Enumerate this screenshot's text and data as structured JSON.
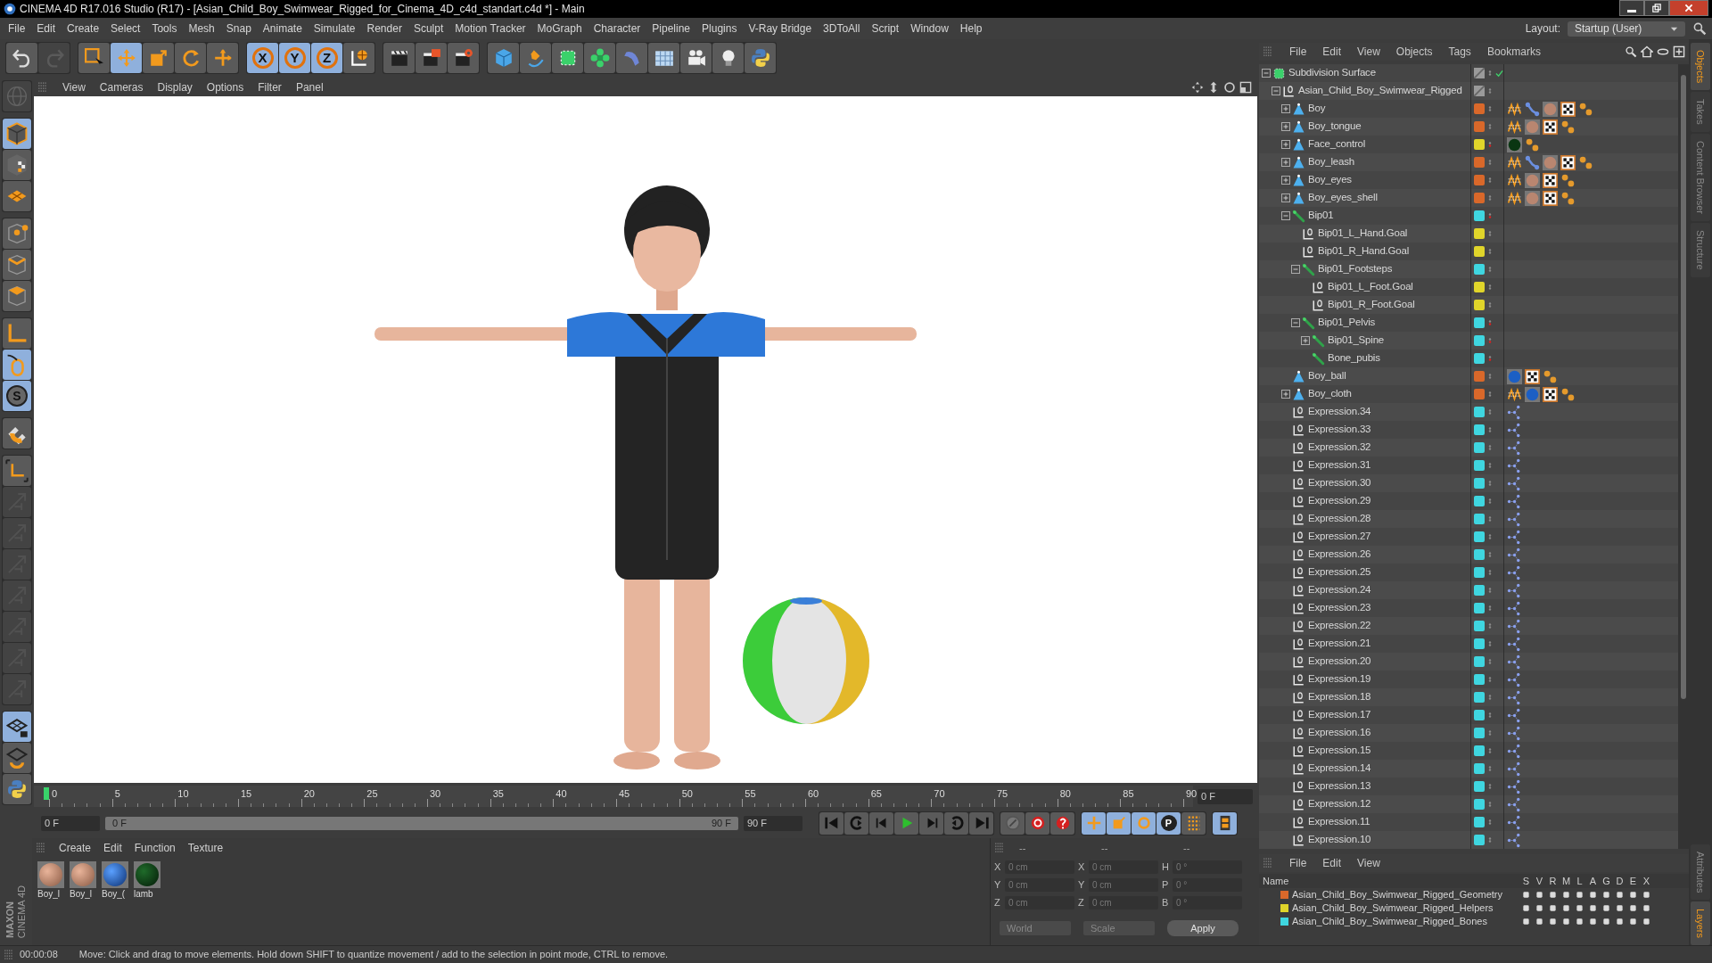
{
  "window": {
    "title": "CINEMA 4D R17.016 Studio (R17) - [Asian_Child_Boy_Swimwear_Rigged_for_Cinema_4D_c4d_standart.c4d *] - Main"
  },
  "menu": [
    "File",
    "Edit",
    "Create",
    "Select",
    "Tools",
    "Mesh",
    "Snap",
    "Animate",
    "Simulate",
    "Render",
    "Sculpt",
    "Motion Tracker",
    "MoGraph",
    "Character",
    "Pipeline",
    "Plugins",
    "V-Ray Bridge",
    "3DToAll",
    "Script",
    "Window",
    "Help"
  ],
  "layout": {
    "label": "Layout:",
    "value": "Startup (User)"
  },
  "toolbar_groups": [
    {
      "items": [
        {
          "kind": "undo",
          "selected": false,
          "disabled": false
        },
        {
          "kind": "redo",
          "selected": false,
          "disabled": true
        }
      ]
    },
    {
      "items": [
        {
          "kind": "select",
          "selected": false,
          "disabled": false
        },
        {
          "kind": "move",
          "selected": true,
          "disabled": false
        },
        {
          "kind": "scale",
          "selected": false,
          "disabled": false
        },
        {
          "kind": "rotate",
          "selected": false,
          "disabled": false
        },
        {
          "kind": "cross",
          "selected": false,
          "disabled": false
        }
      ]
    },
    {
      "items": [
        {
          "kind": "axis",
          "label": "X",
          "selected": true,
          "disabled": false
        },
        {
          "kind": "axis",
          "label": "Y",
          "selected": true,
          "disabled": false
        },
        {
          "kind": "axis",
          "label": "Z",
          "selected": true,
          "disabled": false
        },
        {
          "kind": "world",
          "selected": false,
          "disabled": false
        }
      ]
    },
    {
      "items": [
        {
          "kind": "clapper",
          "selected": false,
          "disabled": false
        },
        {
          "kind": "clapper-box",
          "selected": false,
          "disabled": false
        },
        {
          "kind": "clapper-gear",
          "selected": false,
          "disabled": false
        }
      ]
    },
    {
      "items": [
        {
          "kind": "cube",
          "selected": false,
          "disabled": false
        },
        {
          "kind": "pen",
          "selected": false,
          "disabled": false
        },
        {
          "kind": "green-cube",
          "selected": false,
          "disabled": false
        },
        {
          "kind": "cloner",
          "selected": false,
          "disabled": false
        },
        {
          "kind": "bend",
          "selected": false,
          "disabled": false
        },
        {
          "kind": "floor",
          "selected": false,
          "disabled": false
        },
        {
          "kind": "camera",
          "selected": false,
          "disabled": false
        },
        {
          "kind": "bulb",
          "selected": false,
          "disabled": false
        },
        {
          "kind": "python",
          "selected": false,
          "disabled": false
        }
      ]
    }
  ],
  "left_tool_groups": [
    {
      "items": [
        {
          "kind": "globe",
          "selected": false,
          "disabled": true
        }
      ]
    },
    {
      "items": [
        {
          "kind": "cube-outline",
          "selected": true,
          "disabled": false
        },
        {
          "kind": "checker-cube",
          "selected": false,
          "disabled": false
        },
        {
          "kind": "grid-plane",
          "selected": false,
          "disabled": false
        }
      ]
    },
    {
      "items": [
        {
          "kind": "points",
          "selected": false,
          "disabled": false
        },
        {
          "kind": "edges",
          "selected": false,
          "disabled": false
        },
        {
          "kind": "polygons",
          "selected": false,
          "disabled": false
        }
      ]
    },
    {
      "items": [
        {
          "kind": "axis-l",
          "selected": false,
          "disabled": false
        },
        {
          "kind": "mouse",
          "selected": true,
          "disabled": false
        },
        {
          "kind": "s-circle",
          "label": "S",
          "selected": true,
          "disabled": false
        }
      ]
    },
    {
      "items": [
        {
          "kind": "magnet",
          "selected": false,
          "disabled": false
        }
      ]
    },
    {
      "items": [
        {
          "kind": "axis-bracket",
          "selected": false,
          "disabled": false
        },
        {
          "kind": "arrows",
          "selected": false,
          "disabled": true
        },
        {
          "kind": "arrows",
          "selected": false,
          "disabled": true
        },
        {
          "kind": "arrows",
          "selected": false,
          "disabled": true
        },
        {
          "kind": "arrows",
          "selected": false,
          "disabled": true
        },
        {
          "kind": "arrows",
          "selected": false,
          "disabled": true
        },
        {
          "kind": "arrows",
          "selected": false,
          "disabled": true
        },
        {
          "kind": "arrows",
          "selected": false,
          "disabled": true
        }
      ]
    },
    {
      "items": [
        {
          "kind": "grid-lock",
          "selected": true,
          "disabled": false
        },
        {
          "kind": "grid-rotate",
          "selected": false,
          "disabled": false
        },
        {
          "kind": "python",
          "selected": false,
          "disabled": false
        }
      ]
    }
  ],
  "viewport": {
    "menu": [
      "View",
      "Cameras",
      "Display",
      "Options",
      "Filter",
      "Panel"
    ]
  },
  "timeline": {
    "ticks": [
      "0",
      "5",
      "10",
      "15",
      "20",
      "25",
      "30",
      "35",
      "40",
      "45",
      "50",
      "55",
      "60",
      "65",
      "70",
      "75",
      "80",
      "85",
      "90"
    ],
    "current_frame": "0 F"
  },
  "playback": {
    "start": "0 F",
    "range_start": "0 F",
    "range_end": "90 F",
    "level": 1,
    "end": "90 F",
    "buttons": [
      {
        "kind": "to-start",
        "selected": false
      },
      {
        "kind": "prev-key",
        "selected": false
      },
      {
        "kind": "prev-frame",
        "selected": false
      },
      {
        "kind": "play",
        "selected": false
      },
      {
        "kind": "next-frame",
        "selected": false
      },
      {
        "kind": "next-key",
        "selected": false
      },
      {
        "kind": "to-end",
        "selected": false
      },
      {
        "kind": "key-off",
        "selected": false
      },
      {
        "kind": "record",
        "selected": false
      },
      {
        "kind": "auto-key",
        "selected": false
      },
      {
        "kind": "key-move",
        "selected": true
      },
      {
        "kind": "key-scale",
        "selected": true
      },
      {
        "kind": "key-rotate",
        "selected": true
      },
      {
        "kind": "key-param",
        "label": "P",
        "selected": true
      },
      {
        "kind": "key-grid",
        "selected": false
      },
      {
        "kind": "timeline",
        "selected": true
      }
    ]
  },
  "materials": {
    "menu": [
      "Create",
      "Edit",
      "Function",
      "Texture"
    ],
    "items": [
      {
        "label": "Boy_l",
        "kind": "skin"
      },
      {
        "label": "Boy_l",
        "kind": "skin"
      },
      {
        "label": "Boy_(",
        "kind": "blue"
      },
      {
        "label": "lamb",
        "kind": "dark"
      }
    ]
  },
  "coordinates": {
    "headers": [
      "--",
      "--",
      "--"
    ],
    "rows": [
      [
        {
          "axis": "X",
          "value": "0 cm"
        },
        {
          "axis": "X",
          "value": "0 cm"
        },
        {
          "axis": "H",
          "value": "0 °"
        }
      ],
      [
        {
          "axis": "Y",
          "value": "0 cm"
        },
        {
          "axis": "Y",
          "value": "0 cm"
        },
        {
          "axis": "P",
          "value": "0 °"
        }
      ],
      [
        {
          "axis": "Z",
          "value": "0 cm"
        },
        {
          "axis": "Z",
          "value": "0 cm"
        },
        {
          "axis": "B",
          "value": "0 °"
        }
      ]
    ],
    "mode": "World",
    "transform": "Scale",
    "apply": "Apply"
  },
  "status_bar": {
    "time": "00:00:08",
    "message": "Move: Click and drag to move elements. Hold down SHIFT to quantize movement / add to the selection in point mode, CTRL to remove."
  },
  "object_manager": {
    "menu": [
      "File",
      "Edit",
      "View",
      "Objects",
      "Tags",
      "Bookmarks"
    ],
    "objects": [
      {
        "name": "Subdivision Surface",
        "kind": "generator",
        "expanded": true,
        "render_off": false,
        "children": [
          {
            "name": "Asian_Child_Boy_Swimwear_Rigged",
            "kind": "null",
            "expanded": true,
            "render_off": false,
            "children": [
              {
                "name": "Boy",
                "kind": "polygon",
                "expanded": false,
                "render_off": false,
                "color": "#d9682a",
                "tags": [
                  {
                    "kind": "phong"
                  },
                  {
                    "kind": "ik"
                  },
                  {
                    "kind": "skin"
                  },
                  {
                    "kind": "checker"
                  },
                  {
                    "kind": "dots"
                  }
                ]
              },
              {
                "name": "Boy_tongue",
                "kind": "polygon",
                "expanded": false,
                "render_off": false,
                "color": "#d9682a",
                "tags": [
                  {
                    "kind": "phong"
                  },
                  {
                    "kind": "skin"
                  },
                  {
                    "kind": "checker"
                  },
                  {
                    "kind": "dots"
                  }
                ]
              },
              {
                "name": "Face_control",
                "kind": "polygon",
                "expanded": false,
                "render_off": true,
                "color": "#e0d52a",
                "tags": [
                  {
                    "kind": "dark"
                  },
                  {
                    "kind": "dots"
                  }
                ]
              },
              {
                "name": "Boy_leash",
                "kind": "polygon",
                "expanded": false,
                "render_off": false,
                "color": "#d9682a",
                "tags": [
                  {
                    "kind": "phong"
                  },
                  {
                    "kind": "ik"
                  },
                  {
                    "kind": "skin"
                  },
                  {
                    "kind": "checker"
                  },
                  {
                    "kind": "dots"
                  }
                ]
              },
              {
                "name": "Boy_eyes",
                "kind": "polygon",
                "expanded": false,
                "render_off": false,
                "color": "#d9682a",
                "tags": [
                  {
                    "kind": "phong"
                  },
                  {
                    "kind": "skin"
                  },
                  {
                    "kind": "checker"
                  },
                  {
                    "kind": "dots"
                  }
                ]
              },
              {
                "name": "Boy_eyes_shell",
                "kind": "polygon",
                "expanded": false,
                "render_off": false,
                "color": "#d9682a",
                "tags": [
                  {
                    "kind": "phong"
                  },
                  {
                    "kind": "skin"
                  },
                  {
                    "kind": "checker"
                  },
                  {
                    "kind": "dots"
                  }
                ]
              },
              {
                "name": "Bip01",
                "kind": "bone",
                "expanded": true,
                "render_off": true,
                "color": "#3fd6e0",
                "children": [
                  {
                    "name": "Bip01_L_Hand.Goal",
                    "kind": "null",
                    "render_off": false,
                    "color": "#e0d52a"
                  },
                  {
                    "name": "Bip01_R_Hand.Goal",
                    "kind": "null",
                    "render_off": false,
                    "color": "#e0d52a"
                  },
                  {
                    "name": "Bip01_Footsteps",
                    "kind": "bone",
                    "expanded": true,
                    "render_off": false,
                    "color": "#3fd6e0",
                    "children": [
                      {
                        "name": "Bip01_L_Foot.Goal",
                        "kind": "null",
                        "render_off": false,
                        "color": "#e0d52a"
                      },
                      {
                        "name": "Bip01_R_Foot.Goal",
                        "kind": "null",
                        "render_off": false,
                        "color": "#e0d52a"
                      }
                    ]
                  },
                  {
                    "name": "Bip01_Pelvis",
                    "kind": "bone",
                    "expanded": true,
                    "render_off": true,
                    "color": "#3fd6e0",
                    "children": [
                      {
                        "name": "Bip01_Spine",
                        "kind": "bone",
                        "expanded": false,
                        "render_off": true,
                        "color": "#3fd6e0"
                      },
                      {
                        "name": "Bone_pubis",
                        "kind": "bone",
                        "render_off": true,
                        "color": "#3fd6e0"
                      }
                    ]
                  }
                ]
              },
              {
                "name": "Boy_ball",
                "kind": "polygon",
                "render_off": false,
                "color": "#d9682a",
                "tags": [
                  {
                    "kind": "blue"
                  },
                  {
                    "kind": "checker"
                  },
                  {
                    "kind": "dots"
                  }
                ]
              },
              {
                "name": "Boy_cloth",
                "kind": "polygon",
                "expanded": false,
                "render_off": false,
                "color": "#d9682a",
                "tags": [
                  {
                    "kind": "phong"
                  },
                  {
                    "kind": "blue"
                  },
                  {
                    "kind": "checker"
                  },
                  {
                    "kind": "dots"
                  }
                ]
              },
              {
                "name": "Expression.34",
                "kind": "null",
                "render_off": false,
                "color": "#3fd6e0",
                "tags": [
                  {
                    "kind": "xpresso"
                  }
                ]
              },
              {
                "name": "Expression.33",
                "kind": "null",
                "render_off": false,
                "color": "#3fd6e0",
                "tags": [
                  {
                    "kind": "xpresso"
                  }
                ]
              },
              {
                "name": "Expression.32",
                "kind": "null",
                "render_off": false,
                "color": "#3fd6e0",
                "tags": [
                  {
                    "kind": "xpresso"
                  }
                ]
              },
              {
                "name": "Expression.31",
                "kind": "null",
                "render_off": false,
                "color": "#3fd6e0",
                "tags": [
                  {
                    "kind": "xpresso"
                  }
                ]
              },
              {
                "name": "Expression.30",
                "kind": "null",
                "render_off": false,
                "color": "#3fd6e0",
                "tags": [
                  {
                    "kind": "xpresso"
                  }
                ]
              },
              {
                "name": "Expression.29",
                "kind": "null",
                "render_off": false,
                "color": "#3fd6e0",
                "tags": [
                  {
                    "kind": "xpresso"
                  }
                ]
              },
              {
                "name": "Expression.28",
                "kind": "null",
                "render_off": false,
                "color": "#3fd6e0",
                "tags": [
                  {
                    "kind": "xpresso"
                  }
                ]
              },
              {
                "name": "Expression.27",
                "kind": "null",
                "render_off": false,
                "color": "#3fd6e0",
                "tags": [
                  {
                    "kind": "xpresso"
                  }
                ]
              },
              {
                "name": "Expression.26",
                "kind": "null",
                "render_off": false,
                "color": "#3fd6e0",
                "tags": [
                  {
                    "kind": "xpresso"
                  }
                ]
              },
              {
                "name": "Expression.25",
                "kind": "null",
                "render_off": false,
                "color": "#3fd6e0",
                "tags": [
                  {
                    "kind": "xpresso"
                  }
                ]
              },
              {
                "name": "Expression.24",
                "kind": "null",
                "render_off": false,
                "color": "#3fd6e0",
                "tags": [
                  {
                    "kind": "xpresso"
                  }
                ]
              },
              {
                "name": "Expression.23",
                "kind": "null",
                "render_off": false,
                "color": "#3fd6e0",
                "tags": [
                  {
                    "kind": "xpresso"
                  }
                ]
              },
              {
                "name": "Expression.22",
                "kind": "null",
                "render_off": false,
                "color": "#3fd6e0",
                "tags": [
                  {
                    "kind": "xpresso"
                  }
                ]
              },
              {
                "name": "Expression.21",
                "kind": "null",
                "render_off": false,
                "color": "#3fd6e0",
                "tags": [
                  {
                    "kind": "xpresso"
                  }
                ]
              },
              {
                "name": "Expression.20",
                "kind": "null",
                "render_off": false,
                "color": "#3fd6e0",
                "tags": [
                  {
                    "kind": "xpresso"
                  }
                ]
              },
              {
                "name": "Expression.19",
                "kind": "null",
                "render_off": false,
                "color": "#3fd6e0",
                "tags": [
                  {
                    "kind": "xpresso"
                  }
                ]
              },
              {
                "name": "Expression.18",
                "kind": "null",
                "render_off": false,
                "color": "#3fd6e0",
                "tags": [
                  {
                    "kind": "xpresso"
                  }
                ]
              },
              {
                "name": "Expression.17",
                "kind": "null",
                "render_off": false,
                "color": "#3fd6e0",
                "tags": [
                  {
                    "kind": "xpresso"
                  }
                ]
              },
              {
                "name": "Expression.16",
                "kind": "null",
                "render_off": false,
                "color": "#3fd6e0",
                "tags": [
                  {
                    "kind": "xpresso"
                  }
                ]
              },
              {
                "name": "Expression.15",
                "kind": "null",
                "render_off": false,
                "color": "#3fd6e0",
                "tags": [
                  {
                    "kind": "xpresso"
                  }
                ]
              },
              {
                "name": "Expression.14",
                "kind": "null",
                "render_off": false,
                "color": "#3fd6e0",
                "tags": [
                  {
                    "kind": "xpresso"
                  }
                ]
              },
              {
                "name": "Expression.13",
                "kind": "null",
                "render_off": false,
                "color": "#3fd6e0",
                "tags": [
                  {
                    "kind": "xpresso"
                  }
                ]
              },
              {
                "name": "Expression.12",
                "kind": "null",
                "render_off": false,
                "color": "#3fd6e0",
                "tags": [
                  {
                    "kind": "xpresso"
                  }
                ]
              },
              {
                "name": "Expression.11",
                "kind": "null",
                "render_off": false,
                "color": "#3fd6e0",
                "tags": [
                  {
                    "kind": "xpresso"
                  }
                ]
              },
              {
                "name": "Expression.10",
                "kind": "null",
                "render_off": false,
                "color": "#3fd6e0",
                "tags": [
                  {
                    "kind": "xpresso"
                  }
                ]
              }
            ]
          }
        ]
      }
    ]
  },
  "layer_manager": {
    "menu": [
      "File",
      "Edit",
      "View"
    ],
    "columns": [
      "Name",
      "S",
      "V",
      "R",
      "M",
      "L",
      "A",
      "G",
      "D",
      "E",
      "X"
    ],
    "layers": [
      {
        "name": "Asian_Child_Boy_Swimwear_Rigged_Geometry",
        "color": "#d9682a"
      },
      {
        "name": "Asian_Child_Boy_Swimwear_Rigged_Helpers",
        "color": "#e0d52a"
      },
      {
        "name": "Asian_Child_Boy_Swimwear_Rigged_Bones",
        "color": "#3fd6e0"
      }
    ]
  },
  "side_tabs": [
    {
      "label": "Objects",
      "selected": true
    },
    {
      "label": "Takes",
      "selected": false
    },
    {
      "label": "Content Browser",
      "selected": false
    },
    {
      "label": "Structure",
      "selected": false
    }
  ],
  "side_tabs_lower": [
    {
      "label": "Attributes",
      "selected": false
    },
    {
      "label": "Layers",
      "selected": true
    }
  ],
  "logo": {
    "brand": "MAXON",
    "product": "CINEMA 4D"
  }
}
